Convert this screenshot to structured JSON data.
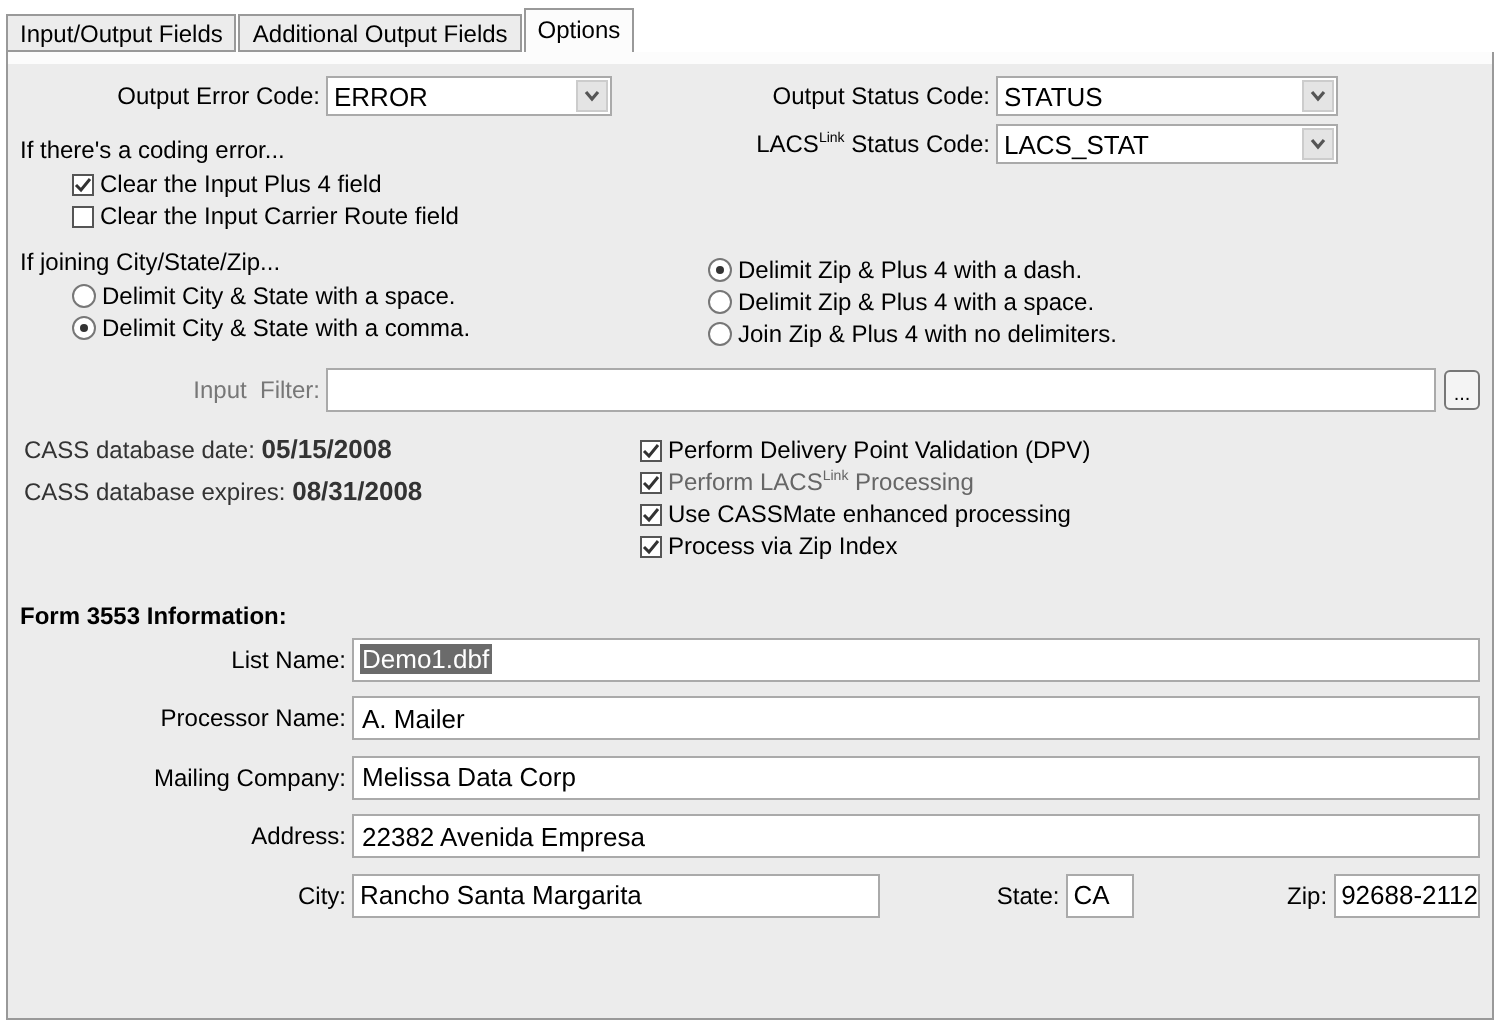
{
  "tabs": [
    {
      "label": "Input/Output Fields",
      "selected": false
    },
    {
      "label": "Additional Output Fields",
      "selected": false
    },
    {
      "label": "Options",
      "selected": true
    }
  ],
  "codes": {
    "left": {
      "label": "Output Error Code:",
      "value": "ERROR"
    },
    "right": [
      {
        "label": "Output Status Code:",
        "value": "STATUS"
      },
      {
        "label": "LACS$^{Link}$ Status Code:",
        "value": "LACS_STAT"
      }
    ]
  },
  "coding_error": {
    "heading": "If there's a coding error...",
    "options": [
      {
        "label": "Clear the Input Plus 4 field",
        "checked": true
      },
      {
        "label": "Clear the Input Carrier Route field",
        "checked": false
      }
    ]
  },
  "joining": {
    "heading": "If joining City/State/Zip...",
    "city_state": [
      {
        "label": "Delimit City & State with a space.",
        "selected": false
      },
      {
        "label": "Delimit City & State with a comma.",
        "selected": true
      }
    ],
    "zip": [
      {
        "label": "Delimit Zip & Plus 4 with a dash.",
        "selected": true
      },
      {
        "label": "Delimit Zip & Plus 4 with a space.",
        "selected": false
      },
      {
        "label": "Join Zip & Plus 4 with no delimiters.",
        "selected": false
      }
    ]
  },
  "input_filter": {
    "label": "Input  Filter:",
    "disabled": true,
    "button": "..."
  },
  "cass": [
    {
      "label": "CASS database date:",
      "value": "05/15/2008"
    },
    {
      "label": "CASS database expires:",
      "value": "08/31/2008"
    }
  ],
  "processing": [
    {
      "label": "Perform Delivery Point Validation (DPV)",
      "checked": true,
      "disabled": false
    },
    {
      "label": "Perform  LACS$^{Link}$ Processing",
      "checked": true,
      "disabled": true
    },
    {
      "label": "Use CASSMate enhanced processing",
      "checked": true,
      "disabled": false
    },
    {
      "label": "Process via Zip Index",
      "checked": true,
      "disabled": false
    }
  ],
  "form_3553": {
    "heading": "Form 3553 Information:",
    "fields": [
      {
        "label": "List Name:",
        "value": "Demo1.dbf",
        "highlighted": true
      },
      {
        "label": "Processor Name:",
        "value": "A. Mailer",
        "highlighted": false
      },
      {
        "label": "Mailing Company:",
        "value": "Melissa Data Corp",
        "highlighted": false
      },
      {
        "label": "Address:",
        "value": "22382 Avenida Empresa",
        "highlighted": false
      }
    ],
    "city": {
      "label": "City:",
      "value": "Rancho Santa Margarita"
    },
    "state": {
      "label": "State:",
      "value": "CA"
    },
    "zip": {
      "label": "Zip:",
      "value": "92688-2112"
    }
  }
}
